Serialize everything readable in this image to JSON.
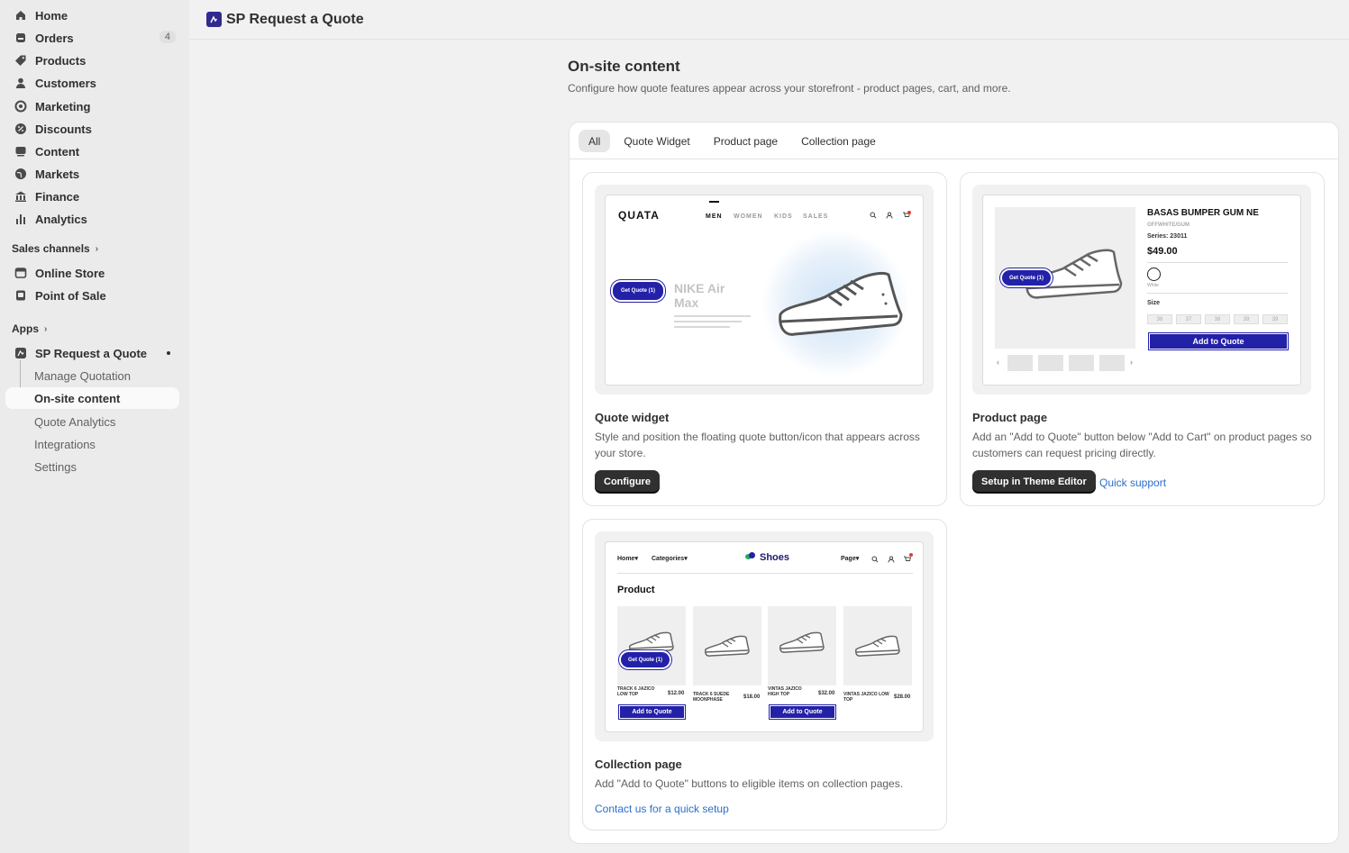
{
  "nav": {
    "items": [
      {
        "label": "Home",
        "icon": "home-icon"
      },
      {
        "label": "Orders",
        "icon": "orders-icon",
        "badge": "4"
      },
      {
        "label": "Products",
        "icon": "tag-icon"
      },
      {
        "label": "Customers",
        "icon": "person-icon"
      },
      {
        "label": "Marketing",
        "icon": "target-icon"
      },
      {
        "label": "Discounts",
        "icon": "discount-icon"
      },
      {
        "label": "Content",
        "icon": "content-icon"
      },
      {
        "label": "Markets",
        "icon": "globe-icon"
      },
      {
        "label": "Finance",
        "icon": "bank-icon"
      },
      {
        "label": "Analytics",
        "icon": "bar-chart-icon"
      }
    ],
    "sales_channels_label": "Sales channels",
    "channels": [
      {
        "label": "Online Store",
        "icon": "store-icon"
      },
      {
        "label": "Point of Sale",
        "icon": "pos-icon"
      }
    ],
    "apps_label": "Apps",
    "app_name": "SP Request a Quote",
    "app_sub": [
      {
        "label": "Manage Quotation"
      },
      {
        "label": "On-site content",
        "active": true
      },
      {
        "label": "Quote Analytics"
      },
      {
        "label": "Integrations"
      },
      {
        "label": "Settings"
      }
    ]
  },
  "topbar": {
    "title": "SP Request a Quote"
  },
  "page": {
    "title": "On-site content",
    "description": "Configure how quote features appear across your storefront - product pages, cart, and more."
  },
  "tabs": [
    {
      "label": "All",
      "active": true
    },
    {
      "label": "Quote Widget"
    },
    {
      "label": "Product page"
    },
    {
      "label": "Collection page"
    }
  ],
  "cards": {
    "widget": {
      "title": "Quote widget",
      "description": "Style and position the floating quote button/icon that appears across your store.",
      "button": "Configure",
      "preview": {
        "logo": "QUATA",
        "nav": [
          "MEN",
          "WOMEN",
          "KIDS",
          "SALES"
        ],
        "pill": "Get Quote (1)",
        "headline": "NIKE Air Max"
      }
    },
    "product": {
      "title": "Product page",
      "description": "Add an \"Add to Quote\" button below \"Add to Cart\" on product pages so customers can request pricing directly.",
      "button": "Setup in Theme Editor",
      "link": "Quick support",
      "preview": {
        "name": "BASAS BUMPER GUM NE",
        "variant": "OFFWHITE/GUM",
        "series": "Series: 23011",
        "price": "$49.00",
        "color_label": "White",
        "size_label": "Size",
        "sizes": [
          "36",
          "37",
          "38",
          "39",
          "39"
        ],
        "pill": "Get Quote (1)",
        "cta": "Add to Quote"
      }
    },
    "collection": {
      "title": "Collection page",
      "description": "Add \"Add to Quote\" buttons to eligible items on collection pages.",
      "link": "Contact us for a quick setup",
      "preview": {
        "nav_home": "Home",
        "nav_categories": "Categories",
        "brand": "Shoes",
        "nav_page": "Page",
        "heading": "Product",
        "pill": "Get Quote (1)",
        "products": [
          {
            "name": "TRACK 6 JAZICO LOW TOP",
            "price": "$12.00",
            "cta": "Add to Quote"
          },
          {
            "name": "TRACK 6 SUEDE MOONPHASE",
            "price": "$18.00"
          },
          {
            "name": "VINTAS JAZICO HIGH TOP",
            "price": "$32.00",
            "cta": "Add to Quote"
          },
          {
            "name": "VINTAS JAZICO LOW TOP",
            "price": "$28.00"
          }
        ]
      }
    }
  },
  "colors": {
    "accent": "#2321a8",
    "link": "#2c6ecb",
    "dark_button": "#303030"
  }
}
